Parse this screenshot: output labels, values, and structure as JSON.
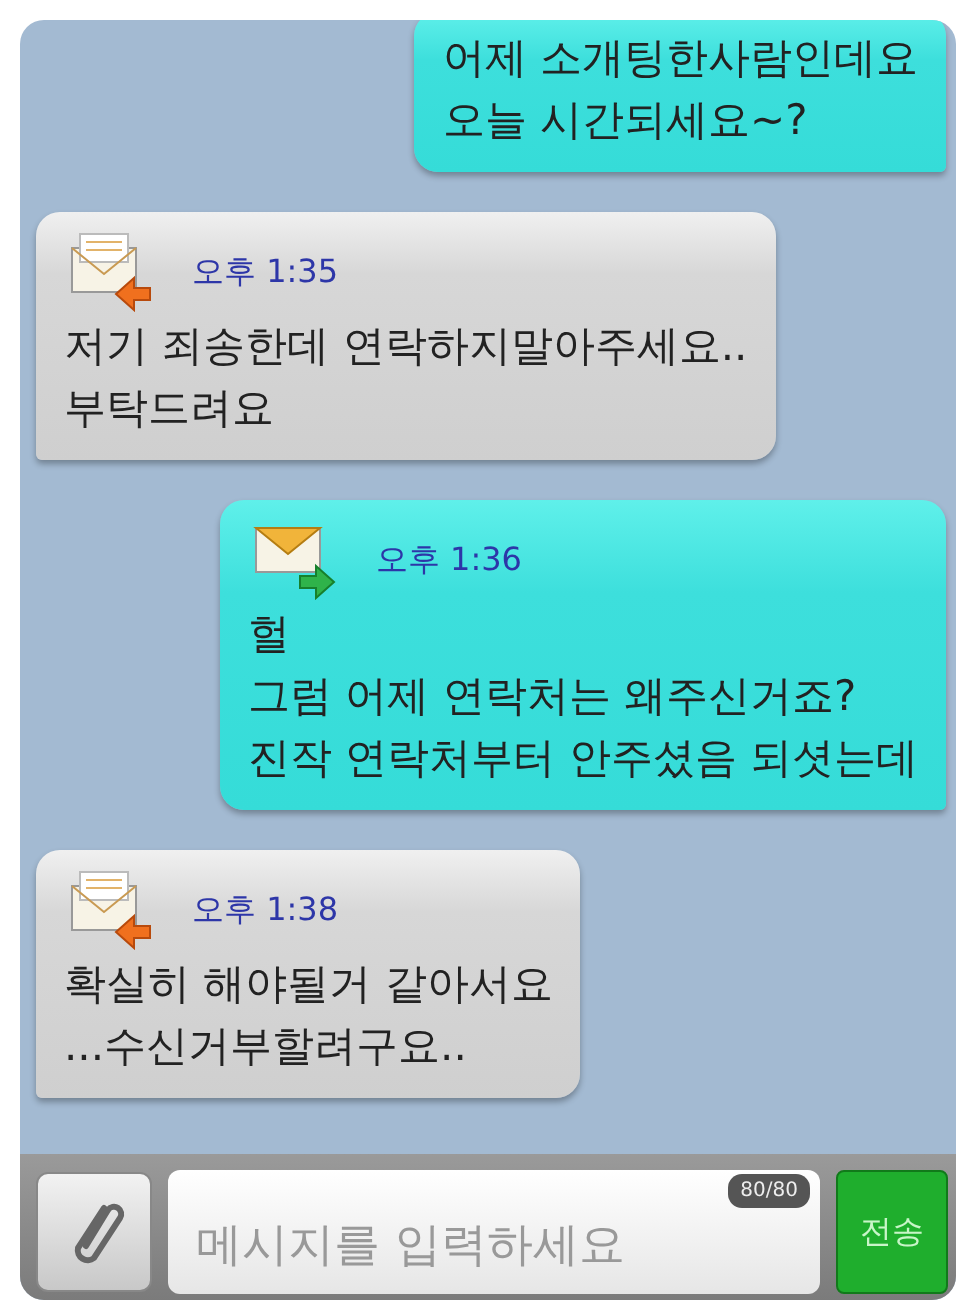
{
  "messages": [
    {
      "kind": "sent",
      "text": "어제 소개팅한사람인데요\n오늘 시간되세요~?"
    },
    {
      "kind": "received",
      "time": "오후 1:35",
      "text": "저기 죄송한데 연락하지말아주세요..\n부탁드려요"
    },
    {
      "kind": "sent",
      "time": "오후 1:36",
      "text": "헐\n그럼 어제 연락처는 왜주신거죠?\n진작 연락처부터 안주셨음 되셧는데"
    },
    {
      "kind": "received",
      "time": "오후 1:38",
      "text": "확실히 해야될거 같아서요\n...수신거부할려구요.."
    }
  ],
  "composer": {
    "placeholder": "메시지를 입력하세요",
    "counter": "80/80",
    "send": "전송"
  }
}
